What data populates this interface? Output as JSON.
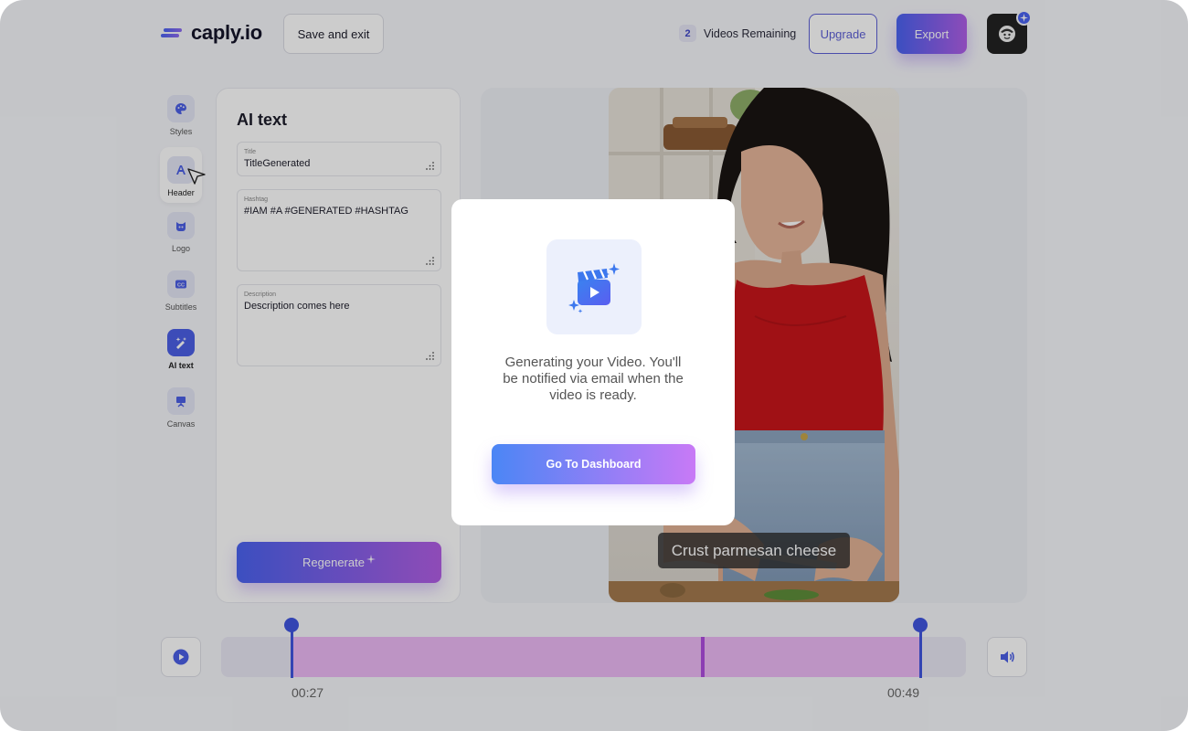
{
  "brand": {
    "name": "caply.io"
  },
  "header": {
    "save_exit_label": "Save and exit",
    "videos_remaining_count": "2",
    "videos_remaining_label": "Videos Remaining",
    "upgrade_label": "Upgrade",
    "export_label": "Export"
  },
  "sidebar": {
    "items": [
      {
        "label": "Styles",
        "icon": "palette-icon"
      },
      {
        "label": "Header",
        "icon": "header-text-icon"
      },
      {
        "label": "Logo",
        "icon": "logo-icon"
      },
      {
        "label": "Subtitles",
        "icon": "subtitles-icon"
      },
      {
        "label": "AI text",
        "icon": "ai-text-icon"
      },
      {
        "label": "Canvas",
        "icon": "canvas-icon"
      }
    ]
  },
  "panel": {
    "title": "AI text",
    "fields": {
      "title": {
        "label": "Title",
        "value": "TitleGenerated"
      },
      "hashtag": {
        "label": "Hashtag",
        "value": "#IAM #A #GENERATED #HASHTAG"
      },
      "description": {
        "label": "Description",
        "value": "Description comes here"
      }
    },
    "regenerate_label": "Regenerate"
  },
  "preview": {
    "caption": "Crust parmesan cheese"
  },
  "timeline": {
    "start_time": "00:27",
    "end_time": "00:49"
  },
  "modal": {
    "message": "Generating your Video. You'll be notified via email when the video is ready.",
    "button_label": "Go To Dashboard"
  },
  "colors": {
    "accent": "#4c5fe6",
    "accent_purple": "#b15ee8",
    "trim_fill": "#edb9f5"
  }
}
